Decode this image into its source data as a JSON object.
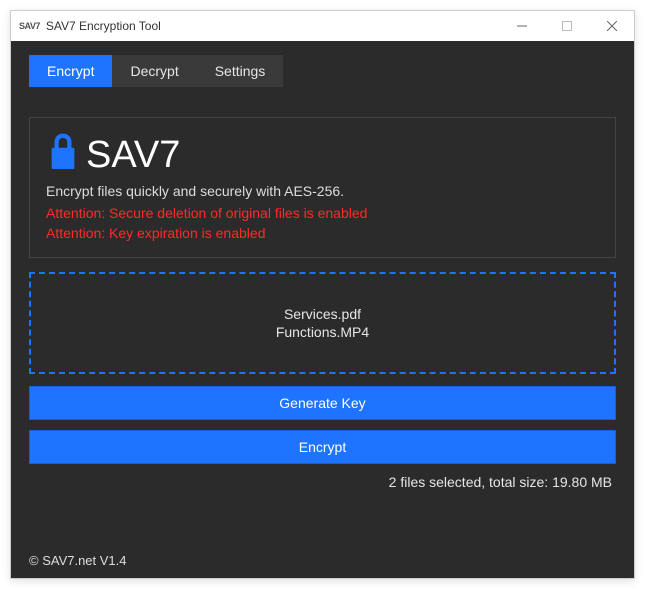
{
  "titlebar": {
    "app_icon_text": "SAV7",
    "title": "SAV7 Encryption Tool"
  },
  "tabs": {
    "encrypt": "Encrypt",
    "decrypt": "Decrypt",
    "settings": "Settings"
  },
  "brand": {
    "name": "SAV7"
  },
  "info": {
    "subtitle": "Encrypt files quickly and securely with AES-256.",
    "warn1": "Attention: Secure deletion of original files is enabled",
    "warn2": "Attention: Key expiration is enabled"
  },
  "files": {
    "item0": "Services.pdf",
    "item1": "Functions.MP4"
  },
  "buttons": {
    "generate_key": "Generate Key",
    "encrypt": "Encrypt"
  },
  "status": {
    "line": "2 files selected, total size: 19.80 MB"
  },
  "footer": {
    "text": "© SAV7.net V1.4"
  }
}
